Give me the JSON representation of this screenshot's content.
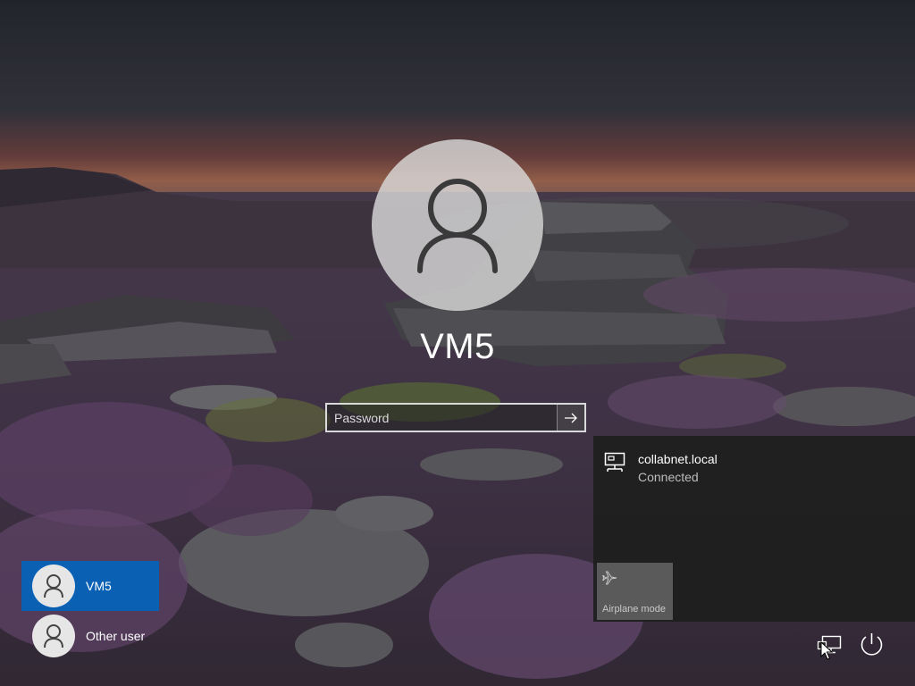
{
  "login": {
    "user_name": "VM5",
    "password_placeholder": "Password"
  },
  "users": [
    {
      "label": "VM5",
      "selected": true
    },
    {
      "label": "Other user",
      "selected": false
    }
  ],
  "network": {
    "name": "collabnet.local",
    "status": "Connected",
    "airplane_mode_label": "Airplane mode"
  },
  "icons": {
    "avatar": "user-icon",
    "submit": "arrow-right-icon",
    "network_item": "ethernet-icon",
    "airplane": "airplane-icon",
    "network_button": "network-icon",
    "power_button": "power-icon"
  },
  "colors": {
    "selected_user": "#0067c0",
    "flyout_bg": "#1f1f1f",
    "airplane_tile": "#5a5a5a",
    "status_text": "#bdbdbd"
  }
}
